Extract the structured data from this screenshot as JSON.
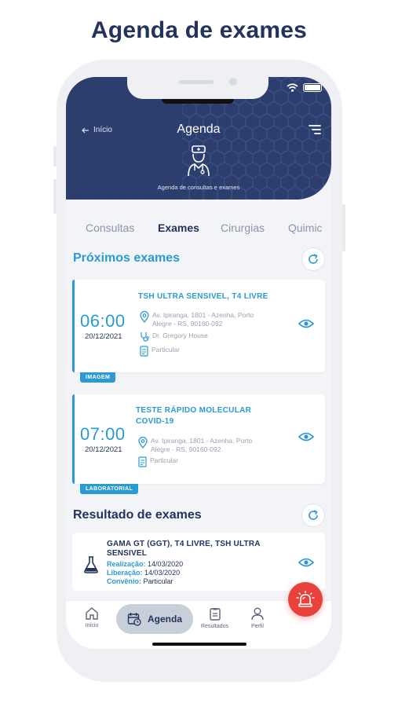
{
  "promo": {
    "title": "Agenda de exames"
  },
  "header": {
    "back_label": "Início",
    "title": "Agenda",
    "subtitle": "Agenda de consultas e exames"
  },
  "tabs": [
    {
      "label": "Consultas",
      "active": false
    },
    {
      "label": "Exames",
      "active": true
    },
    {
      "label": "Cirurgias",
      "active": false
    },
    {
      "label": "Quimic",
      "active": false
    }
  ],
  "upcoming": {
    "title": "Próximos exames",
    "items": [
      {
        "time": "06:00",
        "date": "20/12/2021",
        "title_line1": "TSH ULTRA SENSIVEL, T4 LIVRE",
        "title_line2": "",
        "address_line1": "Av. Ipiranga, 1801 - Azenha, Porto",
        "address_line2": "Alegre - RS, 90160-092",
        "doctor": "Dr. Gregory House",
        "coverage": "Particular",
        "tag": "IMAGEM"
      },
      {
        "time": "07:00",
        "date": "20/12/2021",
        "title_line1": "TESTE RÁPIDO MOLECULAR",
        "title_line2": "COVID-19",
        "address_line1": "Av. Ipiranga, 1801 - Azenha, Porto",
        "address_line2": "Alegre - RS, 90160-092",
        "doctor": "",
        "coverage": "Particular",
        "tag": "LABORATORIAL"
      }
    ]
  },
  "results": {
    "title": "Resultado de exames",
    "items": [
      {
        "title_line1": "GAMA GT (GGT), T4 LIVRE, TSH ULTRA",
        "title_line2": "SENSIVEL",
        "realizacao_label": "Realização:",
        "realizacao": "14/03/2020",
        "liberacao_label": "Liberação:",
        "liberacao": "14/03/2020",
        "convenio_label": "Convênio:",
        "convenio": "Particular"
      }
    ]
  },
  "nav": {
    "home": "Início",
    "agenda": "Agenda",
    "results": "Resultados",
    "profile": "Perfil"
  },
  "colors": {
    "brand_dark": "#2c3e6d",
    "accent_blue": "#2a9ad6",
    "emergency_red": "#e8423a"
  },
  "icons": [
    "wifi-icon",
    "battery-icon",
    "arrow-left-icon",
    "menu-icon",
    "doctor-icon",
    "refresh-icon",
    "location-pin-icon",
    "stethoscope-icon",
    "document-icon",
    "eye-icon",
    "flask-icon",
    "home-icon",
    "calendar-icon",
    "results-icon",
    "user-icon",
    "siren-icon"
  ]
}
